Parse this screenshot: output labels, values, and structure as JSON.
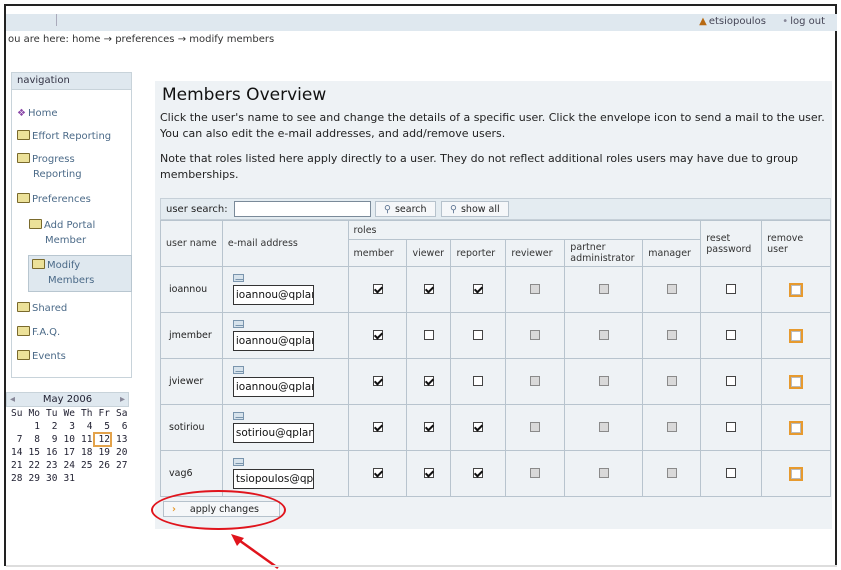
{
  "header": {
    "user": "etsiopoulos",
    "logout": "log out"
  },
  "breadcrumb": {
    "prefix": "ou are here:",
    "home": "home",
    "preferences": "preferences",
    "current": "modify members",
    "sep": "→"
  },
  "nav": {
    "title": "navigation",
    "items": {
      "home": "Home",
      "effort": "Effort Reporting",
      "progress_1": "Progress",
      "progress_2": "Reporting",
      "preferences": "Preferences",
      "add_portal_1": "Add Portal",
      "add_portal_2": "Member",
      "modify_1": "Modify",
      "modify_2": "Members",
      "shared": "Shared",
      "faq": "F.A.Q.",
      "events": "Events"
    }
  },
  "calendar": {
    "month": "May 2006",
    "prev": "◂",
    "next": "▸",
    "weekdays": [
      "Su",
      "Mo",
      "Tu",
      "We",
      "Th",
      "Fr",
      "Sa"
    ],
    "weeks": [
      [
        "",
        "1",
        "2",
        "3",
        "4",
        "5",
        "6"
      ],
      [
        "7",
        "8",
        "9",
        "10",
        "11",
        "12",
        "13"
      ],
      [
        "14",
        "15",
        "16",
        "17",
        "18",
        "19",
        "20"
      ],
      [
        "21",
        "22",
        "23",
        "24",
        "25",
        "26",
        "27"
      ],
      [
        "28",
        "29",
        "30",
        "31",
        "",
        "",
        ""
      ]
    ],
    "today": "12"
  },
  "main": {
    "title": "Members Overview",
    "para1_line1": "Click the user's name to see and change the details of a specific user. Click the envelope icon to send a mail to the user.",
    "para1_line2": "You can also edit the e-mail addresses, and add/remove users.",
    "para2_line1": "Note that roles listed here apply directly to a user. They do not reflect additional roles users may have due to group",
    "para2_line2": "memberships.",
    "search_label": "user search:",
    "search_value": "",
    "search_button": "search",
    "show_all_button": "show all",
    "apply_button": "apply changes"
  },
  "table": {
    "headers": {
      "user_name": "user name",
      "email": "e-mail address",
      "roles": "roles",
      "member": "member",
      "viewer": "viewer",
      "reporter": "reporter",
      "reviewer": "reviewer",
      "partner_admin": "partner administrator",
      "manager": "manager",
      "reset_password": "reset password",
      "remove_user": "remove user"
    },
    "rows": [
      {
        "name": "ioannou",
        "email": "ioannou@qplan.gr",
        "member": true,
        "viewer": true,
        "reporter": true
      },
      {
        "name": "jmember",
        "email": "ioannou@qplan.gr",
        "member": true,
        "viewer": false,
        "reporter": false
      },
      {
        "name": "jviewer",
        "email": "ioannou@qplan.gr",
        "member": true,
        "viewer": true,
        "reporter": false
      },
      {
        "name": "sotiriou",
        "email": "sotiriou@qplan.gr",
        "member": true,
        "viewer": true,
        "reporter": true
      },
      {
        "name": "vag6",
        "email": "tsiopoulos@qplan.",
        "member": true,
        "viewer": true,
        "reporter": true
      }
    ]
  },
  "colors": {
    "annotation": "#e0141c",
    "accent": "#e79a2e",
    "panel": "#eef2f5"
  }
}
